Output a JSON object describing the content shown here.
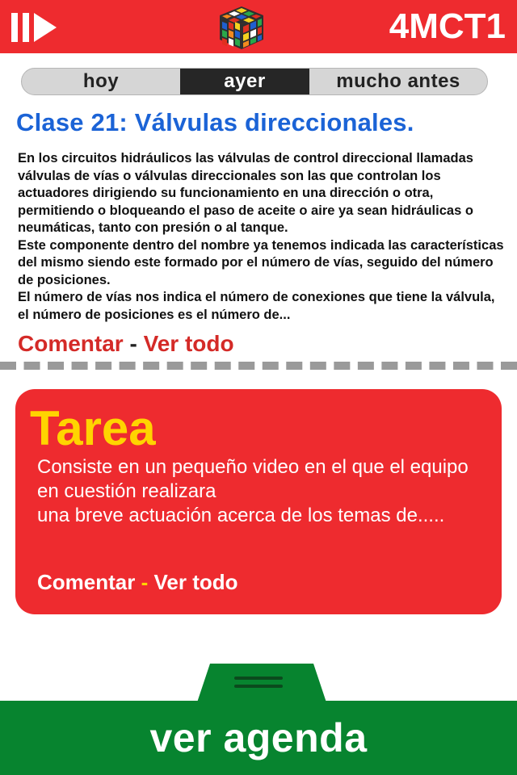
{
  "header": {
    "menu_icon": "double-chevron-icon",
    "logo_icon": "rubik-cube-icon",
    "code": "4MCT1",
    "colors": {
      "background": "#ee2b2f",
      "text": "#ffffff"
    }
  },
  "tabs": [
    {
      "label": "hoy",
      "selected": false
    },
    {
      "label": "ayer",
      "selected": true
    },
    {
      "label": "mucho antes",
      "selected": false
    }
  ],
  "post": {
    "title": "Clase 21: Válvulas direccionales.",
    "paragraphs": [
      "En los circuitos hidráulicos las válvulas de control direccional llamadas válvulas de vías o válvulas direccionales son las que controlan los actuadores dirigiendo su funcionamiento en una dirección o otra, permitiendo o bloqueando el paso de aceite o aire ya sean hidráulicas o neumáticas, tanto con presión o al tanque.",
      "Este componente dentro del nombre ya tenemos indicada las características del mismo siendo este formado por el número de vías, seguido del número de posiciones.",
      "El número de vías nos indica el número de conexiones que tiene la válvula, el número de posiciones es el número de..."
    ],
    "comment_label": "Comentar",
    "separator": "-",
    "view_all_label": "Ver todo"
  },
  "task": {
    "title": "Tarea",
    "lines": [
      "Consiste en un pequeño video en el que el equipo en cuestión realizara",
      "una breve actuación acerca de los temas de....."
    ],
    "comment_label": "Comentar",
    "separator": "-",
    "view_all_label": "Ver todo",
    "colors": {
      "card": "#ee2b2f",
      "title": "#ffd400"
    }
  },
  "agenda": {
    "label": "ver agenda",
    "handle_icon": "drag-handle-icon",
    "colors": {
      "background": "#07842f"
    }
  }
}
